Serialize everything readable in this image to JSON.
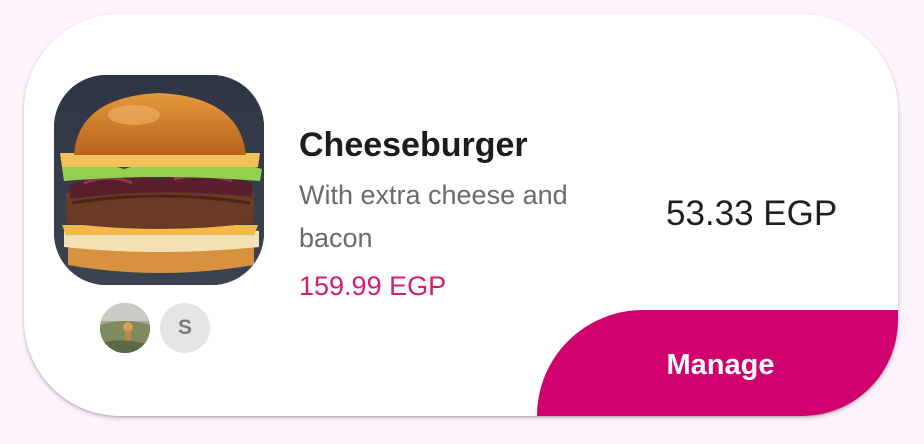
{
  "product": {
    "name": "Cheeseburger",
    "description": "With extra cheese and bacon",
    "original_price": "159.99 EGP",
    "price": "53.33 EGP",
    "image_icon": "burger-image"
  },
  "participants": {
    "photo_icon": "user-photo-avatar",
    "letter": "S"
  },
  "actions": {
    "manage_label": "Manage"
  },
  "colors": {
    "accent": "#d0006f",
    "original_price": "#d81b72",
    "background": "#fdf3fb"
  }
}
